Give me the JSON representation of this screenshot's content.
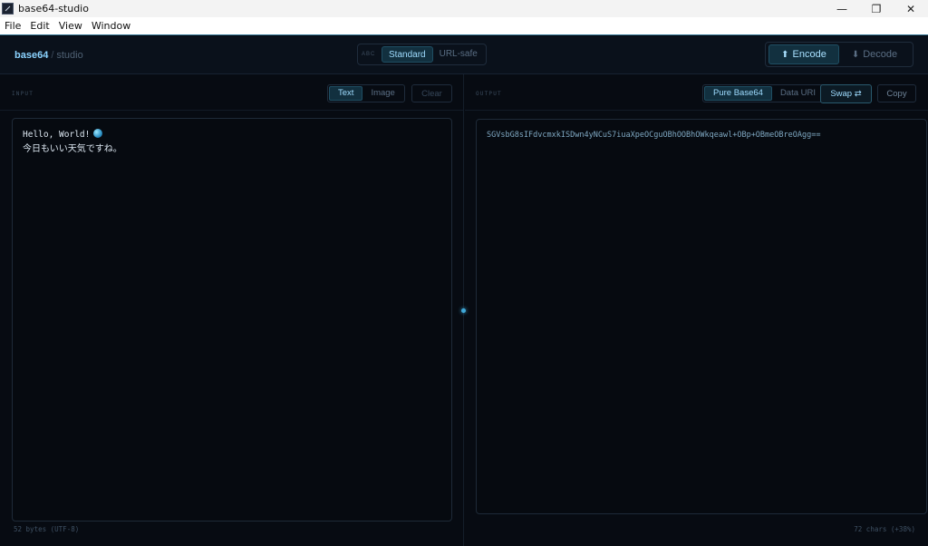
{
  "window": {
    "title": "base64-studio",
    "controls": {
      "minimize": "—",
      "maximize": "❐",
      "close": "✕"
    }
  },
  "menu": [
    "File",
    "Edit",
    "View",
    "Window"
  ],
  "header": {
    "brand_main": "base64",
    "brand_sep": "/",
    "brand_sub": "studio",
    "variant_label": "ABC",
    "variants": [
      "Standard",
      "URL-safe"
    ],
    "active_variant": "Standard",
    "modes": [
      {
        "label": "Encode",
        "icon": "arrow-up-icon",
        "glyph": "⬆"
      },
      {
        "label": "Decode",
        "icon": "arrow-down-icon",
        "glyph": "⬇"
      }
    ],
    "active_mode": "Encode"
  },
  "input_panel": {
    "label": "INPUT",
    "tabs": [
      "Text",
      "Image"
    ],
    "active_tab": "Text",
    "clear_label": "Clear",
    "lines": [
      "Hello, World!",
      "今日もいい天気ですね。"
    ],
    "status": "52 bytes (UTF-8)"
  },
  "output_panel": {
    "label": "OUTPUT",
    "tabs": [
      "Pure Base64",
      "Data URI"
    ],
    "active_tab": "Pure Base64",
    "swap_label": "Swap ⇄",
    "copy_label": "Copy",
    "value": "SGVsbG8sIFdvcmxkISDwn4yNCuS7iuaXpeOCguOBhOOBhOWkqeawl+OBp+OBmeOBreOAgg==",
    "status": "72 chars (+38%)"
  },
  "colors": {
    "background": "#070b12",
    "accent": "#9fdcff",
    "active_bg": "#12303f"
  }
}
